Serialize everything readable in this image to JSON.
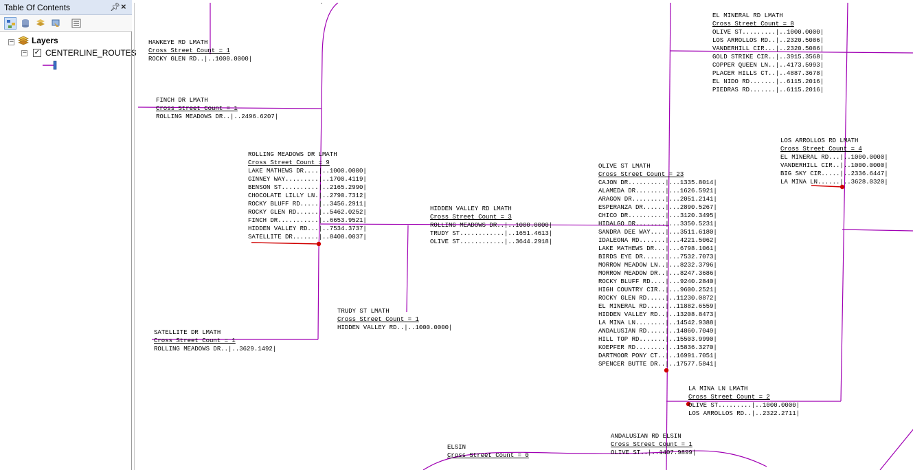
{
  "toc": {
    "title": "Table Of Contents",
    "pin_icon": "pin-icon",
    "close_icon": "close-icon",
    "root_label": "Layers",
    "layer_label": "CENTERLINE_ROUTES",
    "layer_checked": true,
    "expand_symbol": "−"
  },
  "colors": {
    "road": "#a000b4",
    "highlight": "#d00000"
  },
  "labels": {
    "hawkeye": {
      "title": "HAWKEYE RD LMATH",
      "count": "Cross Street Count = 1",
      "rows": [
        "ROCKY GLEN RD..|..1000.0000|"
      ]
    },
    "finch": {
      "title": "FINCH DR LMATH",
      "count": "Cross Street Count = 1",
      "rows": [
        "ROLLING MEADOWS DR..|..2496.6207|"
      ]
    },
    "rolling": {
      "title": "ROLLING MEADOWS DR LMATH",
      "count": "Cross Street Count = 9",
      "rows": [
        "LAKE MATHEWS DR....|..1000.0000|",
        "GINNEY WAY.........|..1700.4119|",
        "BENSON ST..........|..2165.2990|",
        "CHOCOLATE LILLY LN.|..2790.7312|",
        "ROCKY BLUFF RD.....|..3456.2911|",
        "ROCKY GLEN RD......|..5462.0252|",
        "FINCH DR...........|..6653.9521|",
        "HIDDEN VALLEY RD...|..7534.3737|",
        "SATELLITE DR.......|..8408.0037|"
      ]
    },
    "hidden": {
      "title": "HIDDEN VALLEY RD LMATH",
      "count": "Cross Street Count = 3",
      "rows": [
        "ROLLING MEADOWS DR..|..1000.0000|",
        "TRUDY ST............|..1651.4613|",
        "OLIVE ST............|..3644.2918|"
      ]
    },
    "trudy": {
      "title": "TRUDY ST LMATH",
      "count": "Cross Street Count = 1",
      "rows": [
        "HIDDEN VALLEY RD..|..1000.0000|"
      ]
    },
    "satellite": {
      "title": "SATELLITE DR LMATH",
      "count": "Cross Street Count = 1",
      "rows": [
        "ROLLING MEADOWS DR..|..3629.1492|"
      ]
    },
    "olive": {
      "title": "OLIVE ST LMATH",
      "count": "Cross Street Count = 23",
      "rows": [
        "CAJON DR..........|...1335.8014|",
        "ALAMEDA DR........|...1626.5921|",
        "ARAGON DR.........|...2051.2141|",
        "ESPERANZA DR......|...2890.5267|",
        "CHICO DR..........|...3120.3495|",
        "HIDALGO DR........|...3350.5231|",
        "SANDRA DEE WAY....|...3511.6180|",
        "IDALEONA RD.......|...4221.5062|",
        "LAKE MATHEWS DR...|...6798.1061|",
        "BIRDS EYE DR......|...7532.7073|",
        "MORROW MEADOW LN..|...8232.3796|",
        "MORROW MEADOW DR..|...8247.3686|",
        "ROCKY BLUFF RD....|...9240.2840|",
        "HIGH COUNTRY CIR..|...9600.2521|",
        "ROCKY GLEN RD.....|..11230.0872|",
        "EL MINERAL RD.....|..11882.6559|",
        "HIDDEN VALLEY RD..|..13208.8473|",
        "LA MINA LN........|..14542.9388|",
        "ANDALUSIAN RD.....|..14860.7049|",
        "HILL TOP RD.......|..15503.9990|",
        "KOEPFER RD........|..15836.3270|",
        "DARTMOOR PONY CT..|..16991.7051|",
        "SPENCER BUTTE DR..|..17577.5841|"
      ]
    },
    "elmineral": {
      "title": "EL MINERAL RD LMATH",
      "count": "Cross Street Count = 8",
      "rows": [
        "OLIVE ST.........|..1000.0000|",
        "LOS ARROLLOS RD..|..2320.5086|",
        "VANDERHILL CIR...|..2320.5086|",
        "GOLD STRIKE CIR..|..3915.3568|",
        "COPPER QUEEN LN..|..4173.5993|",
        "PLACER HILLS CT..|..4887.3678|",
        "EL NIDO RD.......|..6115.2016|",
        "PIEDRAS RD.......|..6115.2016|"
      ]
    },
    "losarrollos": {
      "title": "LOS ARROLLOS RD LMATH",
      "count": "Cross Street Count = 4",
      "rows": [
        "EL MINERAL RD...|..1000.0000|",
        "VANDERHILL CIR..|..1000.0000|",
        "BIG SKY CIR.....|..2336.6447|",
        "LA MINA LN......|..3628.0320|"
      ]
    },
    "lamina": {
      "title": "LA MINA LN LMATH",
      "count": "Cross Street Count = 2",
      "rows": [
        "OLIVE ST.........|..1000.0000|",
        "LOS ARROLLOS RD..|..2322.2711|"
      ]
    },
    "andalusian": {
      "title": "ANDALUSIAN RD ELSIN",
      "count": "Cross Street Count = 1",
      "rows": [
        "OLIVE ST..|..1407.9899|"
      ]
    },
    "elsin": {
      "title": "ELSIN",
      "count": "Cross Street Count = 0",
      "rows": []
    }
  }
}
